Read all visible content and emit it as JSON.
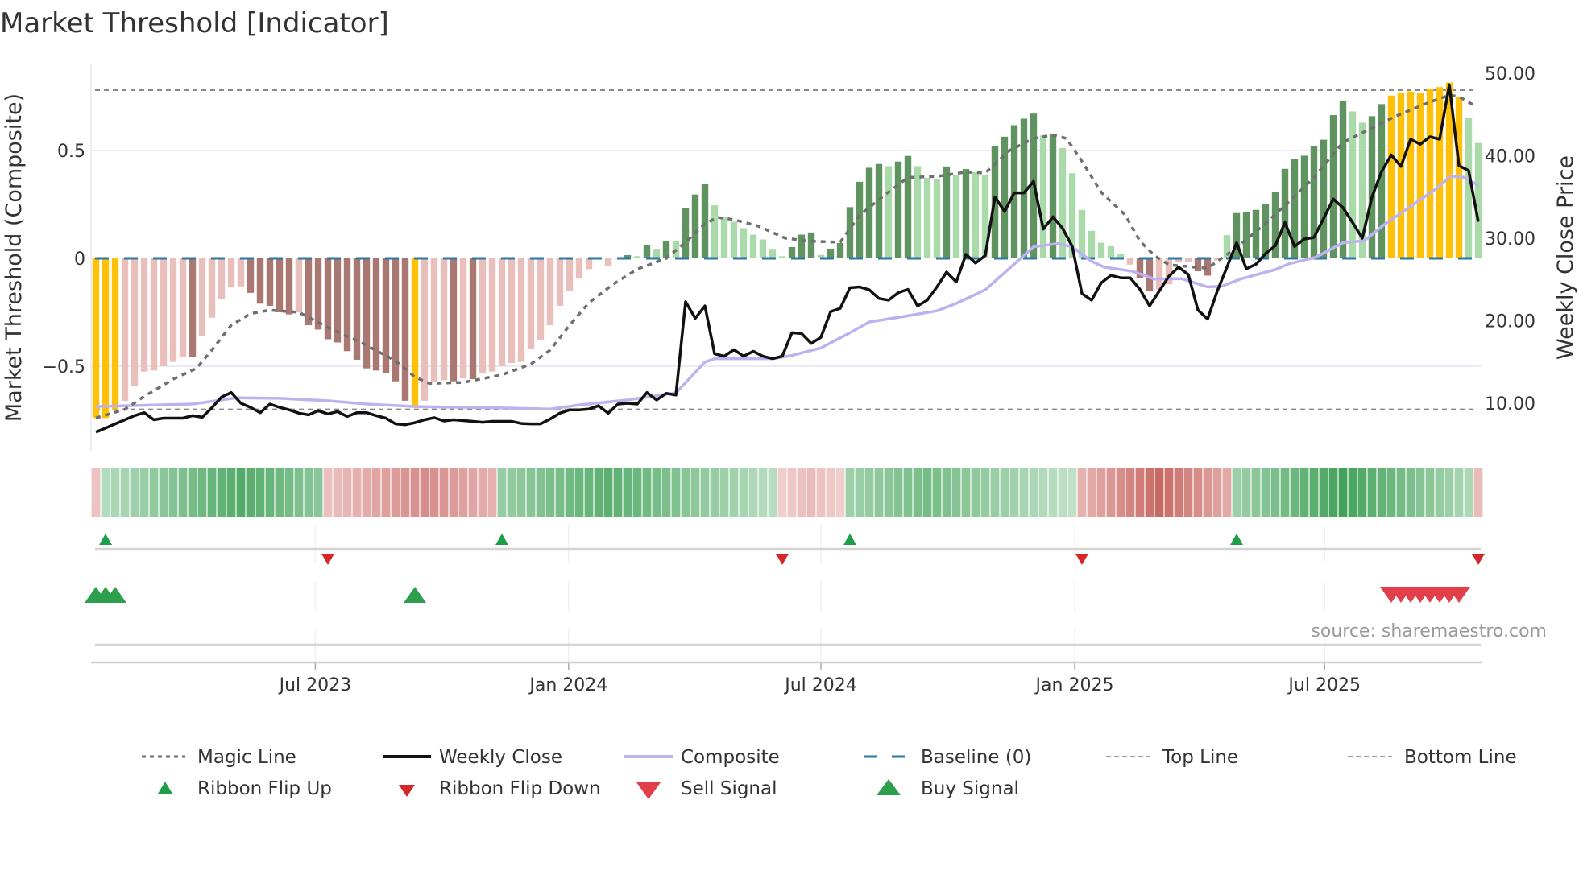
{
  "chart_data": {
    "type": "bar",
    "title": "Market Threshold [Indicator]",
    "ylabel_left": "Market Threshold (Composite)",
    "ylabel_right": "Weekly Close Price",
    "source": "source: sharemaestro.com",
    "ylim_left": [
      -0.83,
      0.9
    ],
    "ylim_right": [
      2.0,
      52.0
    ],
    "left_ticks": [
      {
        "v": 0.5,
        "label": "0.5"
      },
      {
        "v": 0,
        "label": "0"
      },
      {
        "v": -0.5,
        "label": "−0.5"
      }
    ],
    "right_ticks": [
      {
        "v": 50,
        "label": "50.00"
      },
      {
        "v": 40,
        "label": "40.00"
      },
      {
        "v": 30,
        "label": "30.00"
      },
      {
        "v": 20,
        "label": "20.00"
      },
      {
        "v": 10,
        "label": "10.00"
      }
    ],
    "x_ticks": [
      {
        "week": 22.7,
        "label": "Jul 2023"
      },
      {
        "week": 48.9,
        "label": "Jan 2024"
      },
      {
        "week": 75,
        "label": "Jul 2024"
      },
      {
        "week": 101.25,
        "label": "Jan 2025"
      },
      {
        "week": 127.1,
        "label": "Jul 2025"
      }
    ],
    "top_line": 0.78,
    "bottom_line": -0.7,
    "baseline": 0,
    "colors": {
      "signal": "#FFC107",
      "weak_down": "#E8BFBA",
      "strong_down": "#A97872",
      "weak_up": "#AAD9AA",
      "strong_up": "#5F9461",
      "magic": "#6f6f6f",
      "close": "#111111",
      "composite": "#BDB2EE",
      "baseline": "#2E77A3",
      "flip_up": "#1F9E4A",
      "flip_down": "#D62728",
      "sell": "#E23F4B",
      "buy": "#2EA04D"
    },
    "composite": [
      -0.74,
      -0.74,
      -0.7,
      -0.66,
      -0.59,
      -0.525,
      -0.52,
      -0.5,
      -0.48,
      -0.456,
      -0.456,
      -0.36,
      -0.275,
      -0.19,
      -0.135,
      -0.13,
      -0.16,
      -0.21,
      -0.22,
      -0.25,
      -0.26,
      -0.25,
      -0.31,
      -0.33,
      -0.375,
      -0.39,
      -0.43,
      -0.47,
      -0.51,
      -0.52,
      -0.53,
      -0.57,
      -0.66,
      -0.685,
      -0.66,
      -0.575,
      -0.565,
      -0.57,
      -0.556,
      -0.56,
      -0.53,
      -0.525,
      -0.5,
      -0.485,
      -0.48,
      -0.42,
      -0.38,
      -0.31,
      -0.22,
      -0.15,
      -0.094,
      -0.05,
      -0.005,
      -0.035,
      0,
      0.015,
      0.01,
      0.0625,
      0.044,
      0.081,
      0.079,
      0.235,
      0.296,
      0.345,
      0.246,
      0.19,
      0.17,
      0.14,
      0.11,
      0.0875,
      0.044,
      0.01,
      0.0525,
      0.11,
      0.12,
      0.016,
      0.045,
      0.071,
      0.2375,
      0.355,
      0.42,
      0.4375,
      0.4275,
      0.449,
      0.475,
      0.4275,
      0.3725,
      0.369,
      0.426,
      0.3875,
      0.414,
      0.4,
      0.385,
      0.519,
      0.564,
      0.6175,
      0.6475,
      0.671,
      0.569,
      0.5775,
      0.511,
      0.395,
      0.225,
      0.1275,
      0.0725,
      0.056,
      0.021,
      -0.029,
      -0.09,
      -0.1525,
      -0.144,
      -0.12,
      -0.019,
      -0.015,
      -0.06,
      -0.08,
      -0.01,
      0.1075,
      0.21,
      0.216,
      0.225,
      0.25,
      0.306,
      0.415,
      0.461,
      0.476,
      0.521,
      0.55,
      0.664,
      0.731,
      0.681,
      0.629,
      0.659,
      0.715,
      0.755,
      0.765,
      0.774,
      0.766,
      0.7875,
      0.794,
      0.815,
      0.7475,
      0.6525,
      0.535
    ],
    "bar_state_runs": [
      [
        0,
        2,
        "signal"
      ],
      [
        3,
        9,
        "weak_down"
      ],
      [
        10,
        10,
        "strong_down"
      ],
      [
        11,
        15,
        "weak_down"
      ],
      [
        16,
        20,
        "strong_down"
      ],
      [
        21,
        21,
        "weak_down"
      ],
      [
        22,
        32,
        "strong_down"
      ],
      [
        33,
        33,
        "signal"
      ],
      [
        34,
        36,
        "weak_down"
      ],
      [
        37,
        37,
        "strong_down"
      ],
      [
        38,
        38,
        "weak_down"
      ],
      [
        39,
        39,
        "strong_down"
      ],
      [
        40,
        54,
        "weak_down"
      ],
      [
        55,
        55,
        "strong_up"
      ],
      [
        56,
        56,
        "weak_up"
      ],
      [
        57,
        57,
        "strong_up"
      ],
      [
        58,
        58,
        "weak_up"
      ],
      [
        59,
        59,
        "strong_up"
      ],
      [
        60,
        60,
        "weak_up"
      ],
      [
        61,
        63,
        "strong_up"
      ],
      [
        64,
        71,
        "weak_up"
      ],
      [
        72,
        74,
        "strong_up"
      ],
      [
        75,
        75,
        "weak_up"
      ],
      [
        76,
        81,
        "strong_up"
      ],
      [
        82,
        82,
        "weak_up"
      ],
      [
        83,
        84,
        "strong_up"
      ],
      [
        85,
        87,
        "weak_up"
      ],
      [
        88,
        88,
        "strong_up"
      ],
      [
        89,
        89,
        "weak_up"
      ],
      [
        90,
        90,
        "strong_up"
      ],
      [
        91,
        92,
        "weak_up"
      ],
      [
        93,
        97,
        "strong_up"
      ],
      [
        98,
        98,
        "weak_up"
      ],
      [
        99,
        99,
        "strong_up"
      ],
      [
        100,
        106,
        "weak_up"
      ],
      [
        107,
        107,
        "weak_down"
      ],
      [
        108,
        109,
        "strong_down"
      ],
      [
        110,
        113,
        "weak_down"
      ],
      [
        114,
        115,
        "strong_down"
      ],
      [
        116,
        116,
        "weak_down"
      ],
      [
        117,
        117,
        "weak_up"
      ],
      [
        118,
        129,
        "strong_up"
      ],
      [
        130,
        131,
        "weak_up"
      ],
      [
        132,
        133,
        "strong_up"
      ],
      [
        134,
        141,
        "signal"
      ],
      [
        142,
        143,
        "weak_up"
      ]
    ],
    "weekly_close": [
      6.5,
      7.0,
      7.5,
      8.0,
      8.5,
      8.86,
      8.0,
      8.2,
      8.2,
      8.2,
      8.5,
      8.3,
      9.45,
      10.75,
      11.3,
      10.0,
      9.5,
      8.86,
      9.9,
      9.5,
      9.2,
      8.8,
      8.6,
      9.1,
      8.7,
      9.0,
      8.4,
      8.86,
      8.86,
      8.5,
      8.2,
      7.5,
      7.4,
      7.65,
      8.0,
      8.25,
      7.85,
      8.0,
      7.9,
      7.8,
      7.7,
      7.8,
      7.8,
      7.8,
      7.55,
      7.5,
      7.5,
      8.1,
      8.8,
      9.2,
      9.2,
      9.3,
      9.7,
      8.8,
      9.9,
      10.0,
      9.9,
      11.3,
      10.4,
      11.2,
      11.0,
      22.3,
      20.3,
      21.8,
      16.0,
      15.7,
      16.5,
      15.7,
      16.3,
      15.7,
      15.4,
      15.7,
      18.55,
      18.45,
      17.25,
      18.0,
      21.1,
      21.5,
      24.0,
      24.1,
      23.75,
      22.7,
      22.5,
      23.4,
      23.8,
      21.8,
      22.5,
      24.1,
      25.9,
      24.7,
      28.05,
      27.0,
      27.9,
      35.0,
      33.25,
      35.5,
      35.5,
      36.9,
      31.1,
      32.6,
      31.2,
      29.0,
      23.3,
      22.5,
      24.6,
      25.5,
      25.2,
      25.2,
      23.8,
      21.8,
      23.6,
      25.4,
      26.5,
      25.6,
      21.3,
      20.2,
      23.6,
      26.5,
      29.45,
      26.3,
      26.85,
      28.15,
      29.1,
      31.9,
      29.0,
      29.9,
      30.1,
      32.4,
      34.75,
      33.7,
      31.9,
      30.0,
      35.0,
      38.1,
      40.1,
      38.7,
      42.0,
      41.4,
      42.3,
      42.0,
      48.6,
      38.8,
      38.2,
      32.0
    ],
    "composite_line": [
      [
        0,
        9.6
      ],
      [
        10,
        9.9
      ],
      [
        14.5,
        10.65
      ],
      [
        19,
        10.6
      ],
      [
        24,
        10.3
      ],
      [
        28,
        9.9
      ],
      [
        33,
        9.6
      ],
      [
        41,
        9.45
      ],
      [
        47,
        9.3
      ],
      [
        50,
        9.8
      ],
      [
        55,
        10.4
      ],
      [
        60,
        11.25
      ],
      [
        63,
        15.0
      ],
      [
        64,
        15.4
      ],
      [
        70,
        15.4
      ],
      [
        72,
        15.8
      ],
      [
        75,
        16.7
      ],
      [
        78,
        18.55
      ],
      [
        80,
        19.85
      ],
      [
        83.5,
        20.5
      ],
      [
        87,
        21.2
      ],
      [
        89,
        22.1
      ],
      [
        92,
        23.75
      ],
      [
        94.5,
        26.35
      ],
      [
        97,
        28.96
      ],
      [
        99.5,
        29.35
      ],
      [
        101,
        28.96
      ],
      [
        103,
        27.2
      ],
      [
        104.3,
        26.5
      ],
      [
        107.2,
        26.0
      ],
      [
        109.5,
        25.05
      ],
      [
        112.3,
        25.1
      ],
      [
        115,
        24.1
      ],
      [
        116.5,
        24.2
      ],
      [
        118.4,
        25.05
      ],
      [
        122,
        26.2
      ],
      [
        123.4,
        26.9
      ],
      [
        126.2,
        27.7
      ],
      [
        129,
        29.45
      ],
      [
        131.2,
        29.7
      ],
      [
        133.2,
        31.6
      ],
      [
        136,
        33.85
      ],
      [
        138.7,
        36.05
      ],
      [
        140.1,
        37.5
      ],
      [
        141.5,
        37.4
      ],
      [
        143,
        36.4
      ]
    ],
    "magic_line": [
      [
        0,
        -0.74
      ],
      [
        3,
        -0.7
      ],
      [
        5,
        -0.64
      ],
      [
        8,
        -0.56
      ],
      [
        10.4,
        -0.51
      ],
      [
        12,
        -0.425
      ],
      [
        14,
        -0.31
      ],
      [
        16,
        -0.256
      ],
      [
        18,
        -0.24
      ],
      [
        21,
        -0.25
      ],
      [
        24,
        -0.32
      ],
      [
        27.6,
        -0.394
      ],
      [
        31,
        -0.475
      ],
      [
        33,
        -0.55
      ],
      [
        34.5,
        -0.58
      ],
      [
        38,
        -0.575
      ],
      [
        42,
        -0.54
      ],
      [
        45,
        -0.49
      ],
      [
        47,
        -0.425
      ],
      [
        49,
        -0.31
      ],
      [
        51,
        -0.206
      ],
      [
        53.5,
        -0.12
      ],
      [
        56,
        -0.05
      ],
      [
        59,
        0
      ],
      [
        61,
        0.075
      ],
      [
        63,
        0.16
      ],
      [
        64.3,
        0.19
      ],
      [
        66,
        0.18
      ],
      [
        68.5,
        0.15
      ],
      [
        71.3,
        0.094
      ],
      [
        73.7,
        0.08
      ],
      [
        77,
        0.075
      ],
      [
        79,
        0.2
      ],
      [
        81.5,
        0.29
      ],
      [
        84,
        0.375
      ],
      [
        87,
        0.38
      ],
      [
        90,
        0.4
      ],
      [
        92,
        0.396
      ],
      [
        94.5,
        0.5
      ],
      [
        97,
        0.556
      ],
      [
        99,
        0.5725
      ],
      [
        100.4,
        0.556
      ],
      [
        102,
        0.45
      ],
      [
        104,
        0.306
      ],
      [
        106.5,
        0.2
      ],
      [
        108,
        0.08
      ],
      [
        109.5,
        0.0125
      ],
      [
        111,
        -0.03
      ],
      [
        115,
        -0.046
      ],
      [
        118,
        0.05
      ],
      [
        120.7,
        0.15
      ],
      [
        124,
        0.2875
      ],
      [
        126,
        0.375
      ],
      [
        129,
        0.5375
      ],
      [
        131.8,
        0.6
      ],
      [
        134.5,
        0.66
      ],
      [
        138,
        0.725
      ],
      [
        140,
        0.756
      ],
      [
        141,
        0.75
      ],
      [
        142.7,
        0.706
      ]
    ],
    "ribbon_segments": [
      {
        "from": 0,
        "to": 0,
        "dir": -1,
        "peak": 0,
        "max": 0.2
      },
      {
        "from": 1,
        "to": 23,
        "dir": 1,
        "peak": 15,
        "max": 0.85
      },
      {
        "from": 24,
        "to": 41,
        "dir": -1,
        "peak": 34,
        "max": 0.6
      },
      {
        "from": 42,
        "to": 70,
        "dir": 1,
        "peak": 53,
        "max": 0.8
      },
      {
        "from": 71,
        "to": 77,
        "dir": -1,
        "peak": 74,
        "max": 0.25
      },
      {
        "from": 78,
        "to": 101,
        "dir": 1,
        "peak": 86,
        "max": 0.65
      },
      {
        "from": 102,
        "to": 117,
        "dir": -1,
        "peak": 110,
        "max": 0.85
      },
      {
        "from": 118,
        "to": 142,
        "dir": 1,
        "peak": 129,
        "max": 0.95
      },
      {
        "from": 143,
        "to": 143,
        "dir": -1,
        "peak": 143,
        "max": 0.25
      }
    ],
    "ribbon_flip_up": [
      1,
      42,
      78,
      118
    ],
    "ribbon_flip_down": [
      24,
      71,
      102,
      143
    ],
    "buy_signals": [
      0,
      1,
      2,
      33
    ],
    "sell_signals": [
      134,
      135,
      136,
      137,
      138,
      139,
      140,
      141
    ],
    "legend": {
      "magic": "Magic Line",
      "close": "Weekly Close",
      "composite": "Composite",
      "baseline": "Baseline (0)",
      "top": "Top Line",
      "bottom": "Bottom Line",
      "flip_up": "Ribbon Flip Up",
      "flip_down": "Ribbon Flip Down",
      "sell": "Sell Signal",
      "buy": "Buy Signal"
    }
  }
}
